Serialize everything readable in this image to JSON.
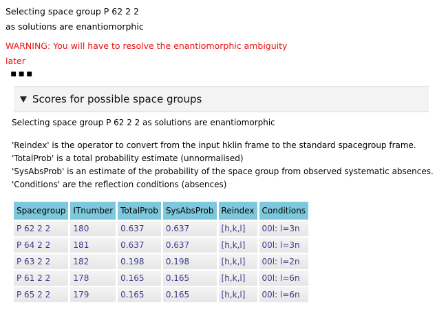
{
  "messages": {
    "top_line1": "Selecting space group P 62 2 2",
    "top_line2": "as solutions are enantiomorphic",
    "warning_line1": "WARNING: You will have to resolve the enantiomorphic ambiguity",
    "warning_line2": "later"
  },
  "dots": "▪▪▪",
  "section": {
    "title": "Scores for possible space groups",
    "selection_text": "Selecting space group P 62 2 2 as solutions are enantiomorphic",
    "notes": [
      "'Reindex' is the operator to convert from the input hklin frame to the standard spacegroup frame.",
      "'TotalProb' is a total probability estimate (unnormalised)",
      "'SysAbsProb' is an estimate of the probability of the space group from observed systematic absences.",
      "'Conditions' are the reflection conditions (absences)"
    ]
  },
  "table": {
    "headers": [
      "Spacegroup",
      "ITnumber",
      "TotalProb",
      "SysAbsProb",
      "Reindex",
      "Conditions"
    ],
    "rows": [
      [
        "P 62 2 2",
        "180",
        "0.637",
        "0.637",
        "[h,k,l]",
        "00l: l=3n"
      ],
      [
        "P 64 2 2",
        "181",
        "0.637",
        "0.637",
        "[h,k,l]",
        "00l: l=3n"
      ],
      [
        "P 63 2 2",
        "182",
        "0.198",
        "0.198",
        "[h,k,l]",
        "00l: l=2n"
      ],
      [
        "P 61 2 2",
        "178",
        "0.165",
        "0.165",
        "[h,k,l]",
        "00l: l=6n"
      ],
      [
        "P 65 2 2",
        "179",
        "0.165",
        "0.165",
        "[h,k,l]",
        "00l: l=6n"
      ]
    ]
  },
  "colors": {
    "warning": "#e8100e",
    "header_bg": "#7ec8de",
    "cell_text": "#3b3b8c"
  }
}
